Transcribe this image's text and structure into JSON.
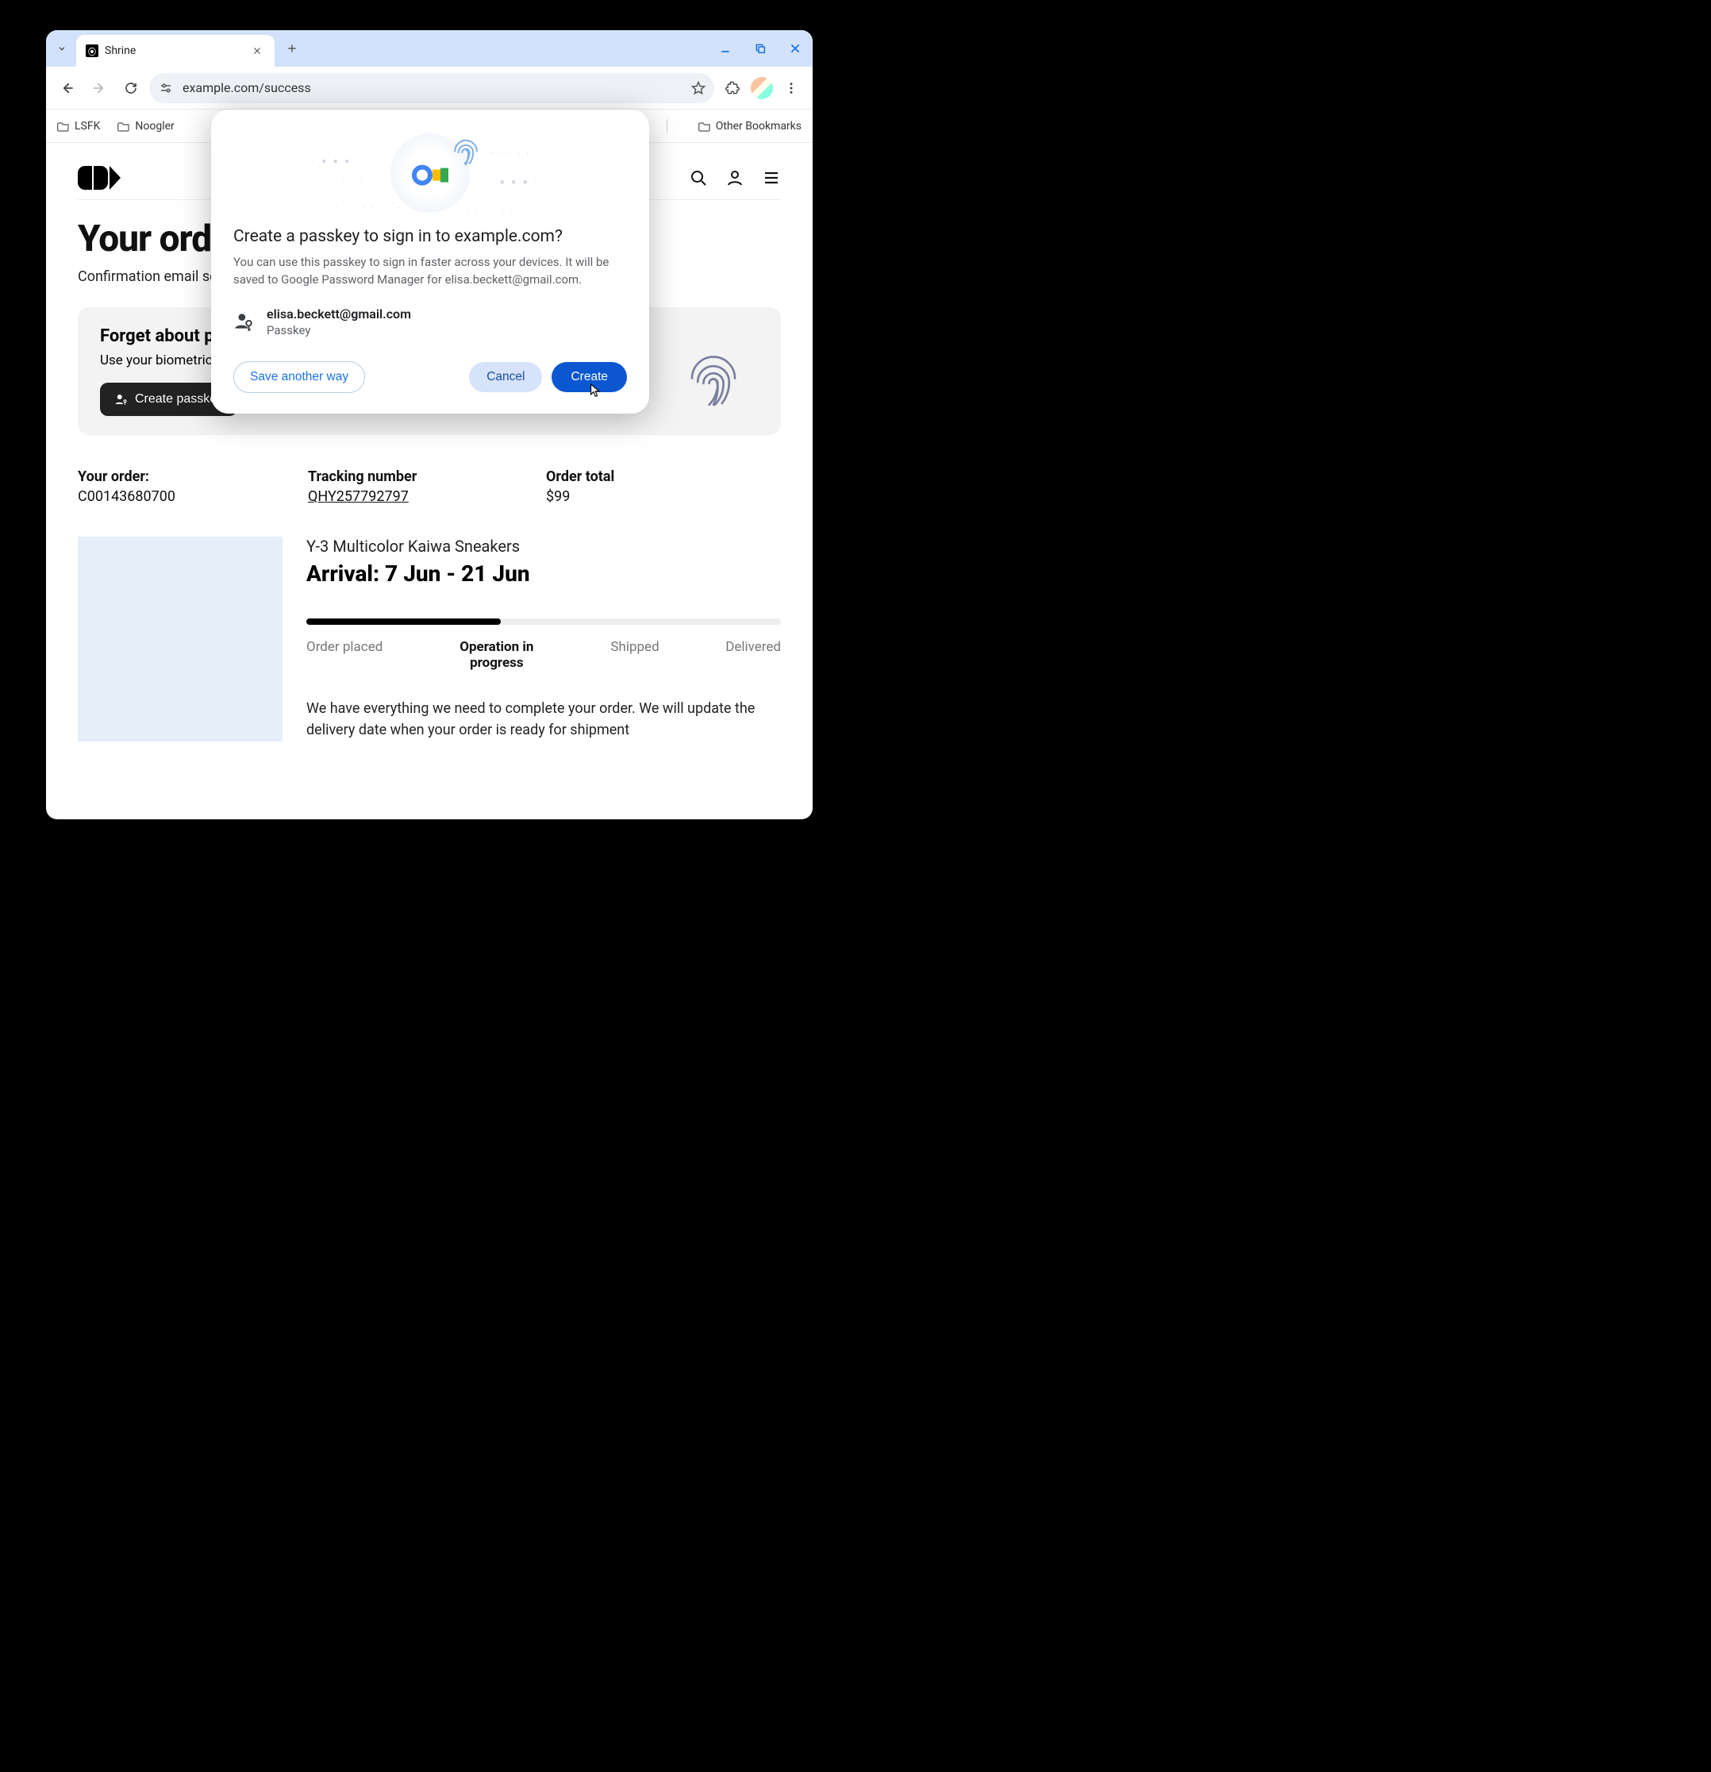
{
  "browser": {
    "tab_title": "Shrine",
    "url": "example.com/success",
    "bookmarks": {
      "items": [
        "LSFK",
        "Noogler"
      ],
      "other": "Other Bookmarks"
    }
  },
  "page": {
    "heading": "Your order placed successfully",
    "confirmation": "Confirmation email sent to elisa.beckett@gmail.com",
    "promo": {
      "title": "Forget about passwords!",
      "body": "Use your biometrics to sign in faster and more securely.",
      "cta": "Create passkey"
    },
    "order": {
      "order_label": "Your order:",
      "order_value": "C00143680700",
      "tracking_label": "Tracking number",
      "tracking_value": "QHY257792797",
      "total_label": "Order total",
      "total_value": "$99"
    },
    "product": {
      "name": "Y-3 Multicolor Kaiwa Sneakers",
      "arrival": "Arrival: 7 Jun - 21 Jun",
      "steps": {
        "s1": "Order placed",
        "s2": "Operation in progress",
        "s3": "Shipped",
        "s4": "Delivered"
      },
      "status": "We have everything we need to complete your order. We will update the delivery date when your order is ready for shipment"
    }
  },
  "dialog": {
    "title": "Create a passkey to sign in to example.com?",
    "desc": "You can use this passkey to sign in faster across your devices. It will be saved to Google Password Manager for elisa.beckett@gmail.com.",
    "email": "elisa.beckett@gmail.com",
    "subtype": "Passkey",
    "save_another": "Save another way",
    "cancel": "Cancel",
    "create": "Create"
  }
}
